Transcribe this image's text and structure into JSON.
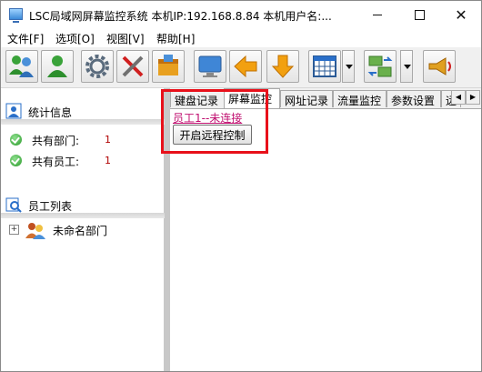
{
  "window": {
    "title": "LSC局域网屏幕监控系统    本机IP:192.168.8.84    本机用户名:..."
  },
  "menu": [
    {
      "label": "文件[F]"
    },
    {
      "label": "选项[O]"
    },
    {
      "label": "视图[V]"
    },
    {
      "label": "帮助[H]"
    }
  ],
  "toolbar": {
    "icons": [
      "users-icon",
      "user-icon",
      "settings-gear-icon",
      "tools-icon",
      "package-icon",
      "monitor-icon",
      "arrow-left-icon",
      "arrow-down-icon",
      "calendar-grid-icon",
      "network-transfer-icon",
      "broadcast-icon"
    ]
  },
  "stats": {
    "header": "统计信息",
    "rows": [
      {
        "label": "共有部门:",
        "value": "1"
      },
      {
        "label": "共有员工:",
        "value": "1"
      }
    ]
  },
  "employees": {
    "header": "员工列表",
    "tree": [
      {
        "label": "未命名部门",
        "expander": "+"
      }
    ]
  },
  "tabs": [
    {
      "label": "键盘记录",
      "active": false
    },
    {
      "label": "屏幕监控",
      "active": true
    },
    {
      "label": "网址记录",
      "active": false
    },
    {
      "label": "流量监控",
      "active": false
    },
    {
      "label": "参数设置",
      "active": false
    },
    {
      "label": "远",
      "active": false
    }
  ],
  "screen_monitor": {
    "status": "员工1--未连接",
    "button": "开启远程控制"
  },
  "colors": {
    "status_text": "#c01070",
    "highlight": "#e8101a",
    "stat_value": "#b00000"
  }
}
